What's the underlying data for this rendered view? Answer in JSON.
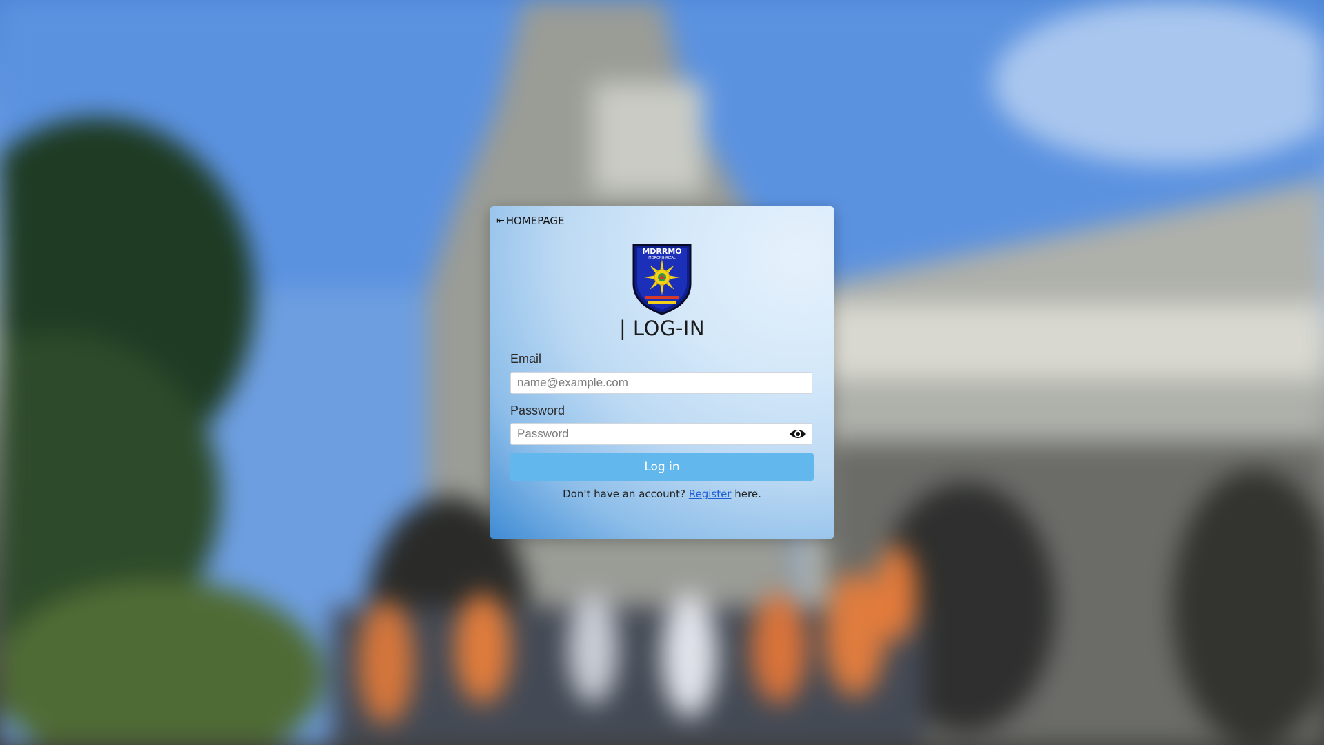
{
  "back_link": {
    "label": "HOMEPAGE",
    "arrow_icon": "arrow-left-bar-icon"
  },
  "logo": {
    "text_top": "MDRRMO",
    "text_sub": "MORONG RIZAL"
  },
  "title": "| LOG-IN",
  "email": {
    "label": "Email",
    "placeholder": "name@example.com",
    "value": ""
  },
  "password": {
    "label": "Password",
    "placeholder": "Password",
    "value": "",
    "toggle_icon": "eye-icon"
  },
  "login_button": {
    "label": "Log in"
  },
  "register": {
    "prefix": "Don't have an account?",
    "link": "Register",
    "suffix": "here."
  },
  "colors": {
    "button": "#62b8ec",
    "link": "#1f5fd6",
    "logo_blue": "#1b2fb8",
    "logo_yellow": "#f5d21a"
  }
}
